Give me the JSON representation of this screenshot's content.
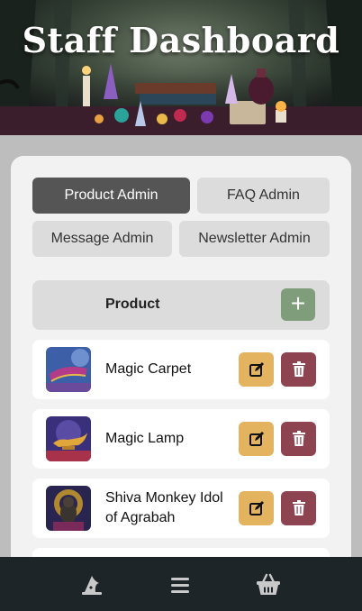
{
  "header": {
    "title": "Staff Dashboard"
  },
  "tabs": [
    {
      "label": "Product Admin",
      "active": true
    },
    {
      "label": "FAQ Admin",
      "active": false
    },
    {
      "label": "Message Admin",
      "active": false
    },
    {
      "label": "Newsletter Admin",
      "active": false
    }
  ],
  "product_list": {
    "header_label": "Product",
    "add_label": "+",
    "items": [
      {
        "name": "Magic Carpet",
        "thumb_icon": "magic-carpet"
      },
      {
        "name": "Magic Lamp",
        "thumb_icon": "magic-lamp"
      },
      {
        "name": "Shiva Monkey Idol of Agrabah",
        "thumb_icon": "monkey-idol"
      }
    ]
  },
  "bottom_nav": {
    "items": [
      {
        "icon": "wizard-hat-icon"
      },
      {
        "icon": "menu-icon"
      },
      {
        "icon": "basket-icon"
      }
    ]
  },
  "colors": {
    "active_tab": "#555555",
    "tab": "#dcdcdc",
    "add": "#7f9c7b",
    "edit": "#e3b35f",
    "delete": "#8e4450",
    "nav_bg": "#1e2528"
  }
}
